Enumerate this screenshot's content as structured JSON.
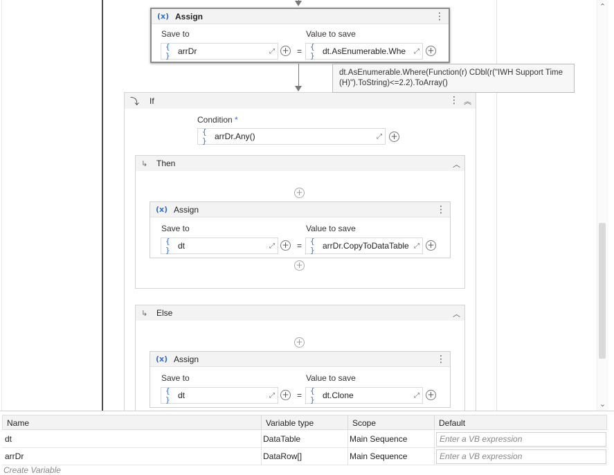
{
  "top_assign": {
    "title": "Assign",
    "icon": "(x)",
    "save_to_label": "Save to",
    "value_label": "Value to save",
    "save_to_value": "arrDr",
    "value_expr": "dt.AsEnumerable.Whe",
    "equals": "="
  },
  "tooltip": {
    "text": "dt.AsEnumerable.Where(Function(r) CDbl(r(\"IWH Support Time (H)\").ToString)<=2.2).ToArray()"
  },
  "if_block": {
    "title": "If",
    "condition_label": "Condition",
    "required_mark": "*",
    "condition_expr": "arrDr.Any()",
    "then": {
      "title": "Then",
      "assign": {
        "title": "Assign",
        "save_to_label": "Save to",
        "value_label": "Value to save",
        "save_to_value": "dt",
        "value_expr": "arrDr.CopyToDataTable",
        "equals": "="
      }
    },
    "else": {
      "title": "Else",
      "assign": {
        "title": "Assign",
        "save_to_label": "Save to",
        "value_label": "Value to save",
        "save_to_value": "dt",
        "value_expr": "dt.Clone",
        "equals": "="
      }
    }
  },
  "variables": {
    "columns": [
      "Name",
      "Variable type",
      "Scope",
      "Default"
    ],
    "rows": [
      {
        "name": "dt",
        "type": "DataTable",
        "scope": "Main Sequence",
        "default_placeholder": "Enter a VB expression"
      },
      {
        "name": "arrDr",
        "type": "DataRow[]",
        "scope": "Main Sequence",
        "default_placeholder": "Enter a VB expression"
      }
    ],
    "create_label": "Create Variable"
  },
  "icons": {
    "braces": "{ }",
    "expand": "⤢",
    "plus": "+",
    "kebab": "⋮",
    "chevron_up": "︿",
    "double_chevron_up": "︽",
    "branch_arrow": "↳",
    "if_icon": "⤵"
  },
  "colors": {
    "accent": "#3a6fc4",
    "sequence_line": "#4a4a4a"
  }
}
